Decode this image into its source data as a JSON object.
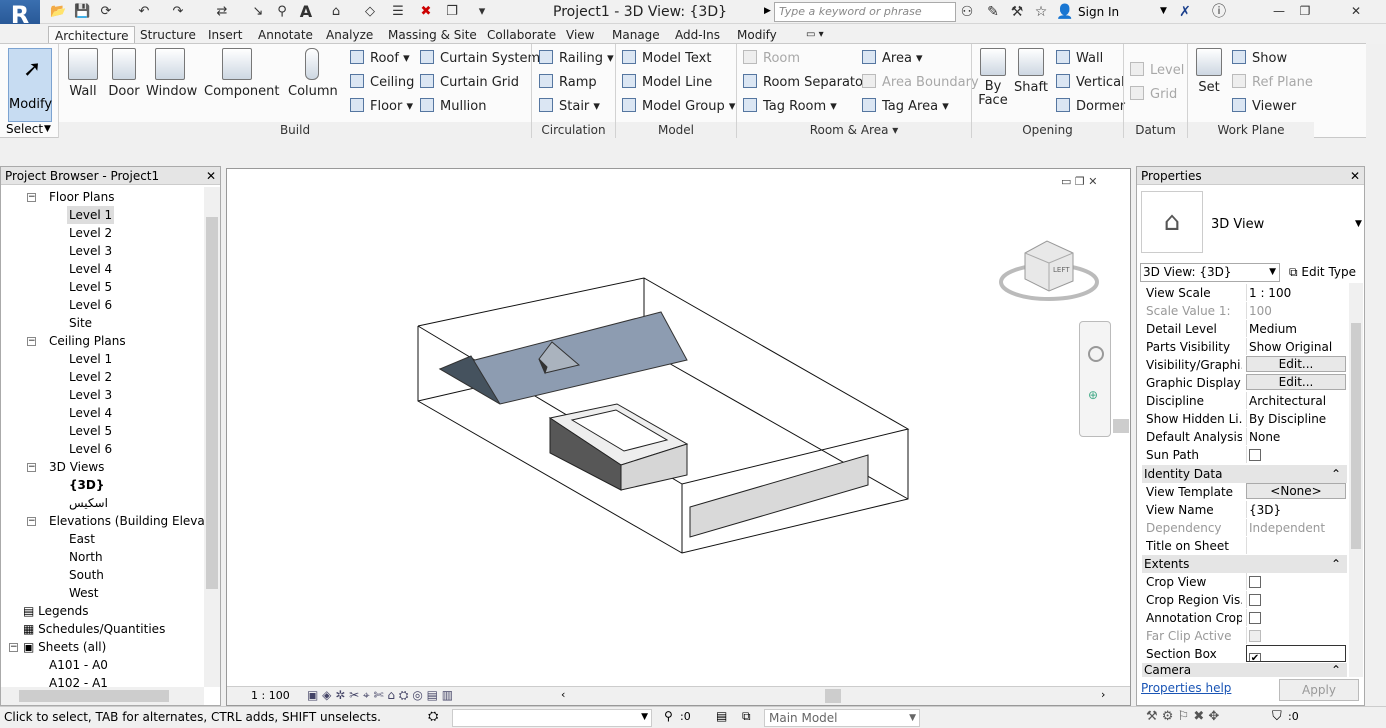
{
  "app": {
    "logo": "R",
    "logo_sub": "A",
    "title": "Project1 - 3D View: {3D}"
  },
  "search": {
    "placeholder": "Type a keyword or phrase"
  },
  "signin": "Sign In",
  "tabs": [
    "Architecture",
    "Structure",
    "Insert",
    "Annotate",
    "Analyze",
    "Massing & Site",
    "Collaborate",
    "View",
    "Manage",
    "Add-Ins",
    "Modify"
  ],
  "ribbon": {
    "modify": "Modify",
    "select": "Select",
    "build": {
      "wall": "Wall",
      "door": "Door",
      "window": "Window",
      "component": "Component",
      "column": "Column",
      "roof": "Roof",
      "ceiling": "Ceiling",
      "floor": "Floor",
      "curtain_system": "Curtain System",
      "curtain_grid": "Curtain Grid",
      "mullion": "Mullion",
      "label": "Build"
    },
    "circulation": {
      "railing": "Railing",
      "ramp": "Ramp",
      "stair": "Stair",
      "label": "Circulation"
    },
    "model": {
      "text": "Model Text",
      "line": "Model Line",
      "group": "Model Group",
      "label": "Model"
    },
    "room": {
      "room": "Room",
      "separator": "Room Separator",
      "tag": "Tag Room",
      "area": "Area",
      "boundary": "Area Boundary",
      "tag_area": "Tag Area",
      "label": "Room & Area"
    },
    "opening": {
      "by": "By",
      "face": "Face",
      "shaft": "Shaft",
      "wall": "Wall",
      "vertical": "Vertical",
      "dormer": "Dormer",
      "label": "Opening"
    },
    "datum": {
      "level": "Level",
      "grid": "Grid",
      "label": "Datum"
    },
    "workplane": {
      "set": "Set",
      "show": "Show",
      "ref": "Ref  Plane",
      "viewer": "Viewer",
      "label": "Work Plane"
    }
  },
  "browser": {
    "title": "Project Browser - Project1",
    "floor": "Floor Plans",
    "floor_items": [
      "Level 1",
      "Level 2",
      "Level 3",
      "Level 4",
      "Level 5",
      "Level 6",
      "Site"
    ],
    "ceiling": "Ceiling Plans",
    "ceiling_items": [
      "Level 1",
      "Level 2",
      "Level 3",
      "Level 4",
      "Level 5",
      "Level 6"
    ],
    "views3d": "3D Views",
    "views3d_items": [
      "{3D}",
      "اسكيس"
    ],
    "elev": "Elevations (Building Elevation",
    "elev_items": [
      "East",
      "North",
      "South",
      "West"
    ],
    "legends": "Legends",
    "schedules": "Schedules/Quantities",
    "sheets": "Sheets (all)",
    "sheet_items": [
      "A101 - A0",
      "A102 - A1"
    ]
  },
  "viewport": {
    "scale": "1 : 100",
    "cube_label": "LEFT"
  },
  "props": {
    "title": "Properties",
    "type": "3D View",
    "selector": "3D View: {3D}",
    "edit_type": "Edit Type",
    "rows": [
      [
        "View Scale",
        "1 : 100"
      ],
      [
        "Scale Value    1:",
        "100"
      ],
      [
        "Detail Level",
        "Medium"
      ],
      [
        "Parts Visibility",
        "Show Original"
      ],
      [
        "Visibility/Graphi...",
        "Edit..."
      ],
      [
        "Graphic Display ...",
        "Edit..."
      ],
      [
        "Discipline",
        "Architectural"
      ],
      [
        "Show Hidden Li...",
        "By Discipline"
      ],
      [
        "Default Analysis...",
        "None"
      ],
      [
        "Sun Path",
        ""
      ]
    ],
    "identity": "Identity Data",
    "idrows": [
      [
        "View Template",
        "<None>"
      ],
      [
        "View Name",
        "{3D}"
      ],
      [
        "Dependency",
        "Independent"
      ],
      [
        "Title on Sheet",
        ""
      ]
    ],
    "extents": "Extents",
    "exrows": [
      [
        "Crop View",
        ""
      ],
      [
        "Crop Region Vis...",
        ""
      ],
      [
        "Annotation Crop",
        ""
      ],
      [
        "Far Clip Active",
        ""
      ],
      [
        "Section Box",
        "✔"
      ]
    ],
    "camera": "Camera",
    "help": "Properties help",
    "apply": "Apply"
  },
  "status": {
    "msg": "Click to select, TAB for alternates, CTRL adds, SHIFT unselects.",
    "count1": ":0",
    "model": "Main Model",
    "count2": ":0"
  }
}
